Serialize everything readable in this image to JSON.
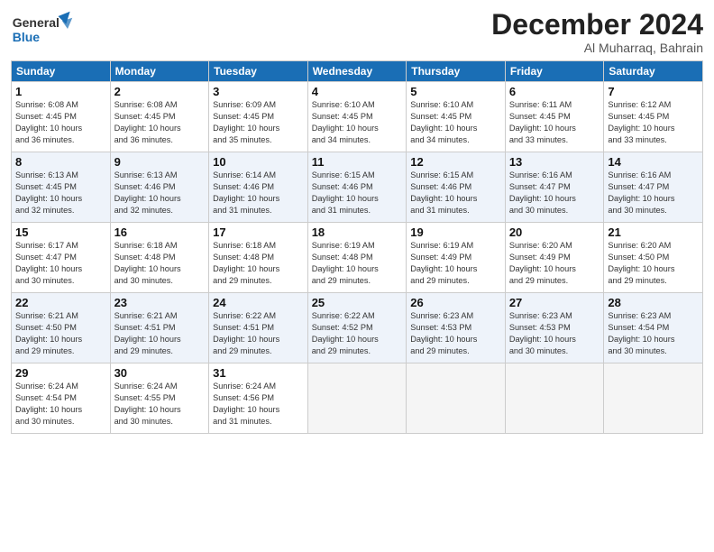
{
  "header": {
    "logo_line1": "General",
    "logo_line2": "Blue",
    "title": "December 2024",
    "location": "Al Muharraq, Bahrain"
  },
  "columns": [
    "Sunday",
    "Monday",
    "Tuesday",
    "Wednesday",
    "Thursday",
    "Friday",
    "Saturday"
  ],
  "weeks": [
    [
      {
        "day": "1",
        "info": "Sunrise: 6:08 AM\nSunset: 4:45 PM\nDaylight: 10 hours\nand 36 minutes."
      },
      {
        "day": "2",
        "info": "Sunrise: 6:08 AM\nSunset: 4:45 PM\nDaylight: 10 hours\nand 36 minutes."
      },
      {
        "day": "3",
        "info": "Sunrise: 6:09 AM\nSunset: 4:45 PM\nDaylight: 10 hours\nand 35 minutes."
      },
      {
        "day": "4",
        "info": "Sunrise: 6:10 AM\nSunset: 4:45 PM\nDaylight: 10 hours\nand 34 minutes."
      },
      {
        "day": "5",
        "info": "Sunrise: 6:10 AM\nSunset: 4:45 PM\nDaylight: 10 hours\nand 34 minutes."
      },
      {
        "day": "6",
        "info": "Sunrise: 6:11 AM\nSunset: 4:45 PM\nDaylight: 10 hours\nand 33 minutes."
      },
      {
        "day": "7",
        "info": "Sunrise: 6:12 AM\nSunset: 4:45 PM\nDaylight: 10 hours\nand 33 minutes."
      }
    ],
    [
      {
        "day": "8",
        "info": "Sunrise: 6:13 AM\nSunset: 4:45 PM\nDaylight: 10 hours\nand 32 minutes."
      },
      {
        "day": "9",
        "info": "Sunrise: 6:13 AM\nSunset: 4:46 PM\nDaylight: 10 hours\nand 32 minutes."
      },
      {
        "day": "10",
        "info": "Sunrise: 6:14 AM\nSunset: 4:46 PM\nDaylight: 10 hours\nand 31 minutes."
      },
      {
        "day": "11",
        "info": "Sunrise: 6:15 AM\nSunset: 4:46 PM\nDaylight: 10 hours\nand 31 minutes."
      },
      {
        "day": "12",
        "info": "Sunrise: 6:15 AM\nSunset: 4:46 PM\nDaylight: 10 hours\nand 31 minutes."
      },
      {
        "day": "13",
        "info": "Sunrise: 6:16 AM\nSunset: 4:47 PM\nDaylight: 10 hours\nand 30 minutes."
      },
      {
        "day": "14",
        "info": "Sunrise: 6:16 AM\nSunset: 4:47 PM\nDaylight: 10 hours\nand 30 minutes."
      }
    ],
    [
      {
        "day": "15",
        "info": "Sunrise: 6:17 AM\nSunset: 4:47 PM\nDaylight: 10 hours\nand 30 minutes."
      },
      {
        "day": "16",
        "info": "Sunrise: 6:18 AM\nSunset: 4:48 PM\nDaylight: 10 hours\nand 30 minutes."
      },
      {
        "day": "17",
        "info": "Sunrise: 6:18 AM\nSunset: 4:48 PM\nDaylight: 10 hours\nand 29 minutes."
      },
      {
        "day": "18",
        "info": "Sunrise: 6:19 AM\nSunset: 4:48 PM\nDaylight: 10 hours\nand 29 minutes."
      },
      {
        "day": "19",
        "info": "Sunrise: 6:19 AM\nSunset: 4:49 PM\nDaylight: 10 hours\nand 29 minutes."
      },
      {
        "day": "20",
        "info": "Sunrise: 6:20 AM\nSunset: 4:49 PM\nDaylight: 10 hours\nand 29 minutes."
      },
      {
        "day": "21",
        "info": "Sunrise: 6:20 AM\nSunset: 4:50 PM\nDaylight: 10 hours\nand 29 minutes."
      }
    ],
    [
      {
        "day": "22",
        "info": "Sunrise: 6:21 AM\nSunset: 4:50 PM\nDaylight: 10 hours\nand 29 minutes."
      },
      {
        "day": "23",
        "info": "Sunrise: 6:21 AM\nSunset: 4:51 PM\nDaylight: 10 hours\nand 29 minutes."
      },
      {
        "day": "24",
        "info": "Sunrise: 6:22 AM\nSunset: 4:51 PM\nDaylight: 10 hours\nand 29 minutes."
      },
      {
        "day": "25",
        "info": "Sunrise: 6:22 AM\nSunset: 4:52 PM\nDaylight: 10 hours\nand 29 minutes."
      },
      {
        "day": "26",
        "info": "Sunrise: 6:23 AM\nSunset: 4:53 PM\nDaylight: 10 hours\nand 29 minutes."
      },
      {
        "day": "27",
        "info": "Sunrise: 6:23 AM\nSunset: 4:53 PM\nDaylight: 10 hours\nand 30 minutes."
      },
      {
        "day": "28",
        "info": "Sunrise: 6:23 AM\nSunset: 4:54 PM\nDaylight: 10 hours\nand 30 minutes."
      }
    ],
    [
      {
        "day": "29",
        "info": "Sunrise: 6:24 AM\nSunset: 4:54 PM\nDaylight: 10 hours\nand 30 minutes."
      },
      {
        "day": "30",
        "info": "Sunrise: 6:24 AM\nSunset: 4:55 PM\nDaylight: 10 hours\nand 30 minutes."
      },
      {
        "day": "31",
        "info": "Sunrise: 6:24 AM\nSunset: 4:56 PM\nDaylight: 10 hours\nand 31 minutes."
      },
      null,
      null,
      null,
      null
    ]
  ]
}
